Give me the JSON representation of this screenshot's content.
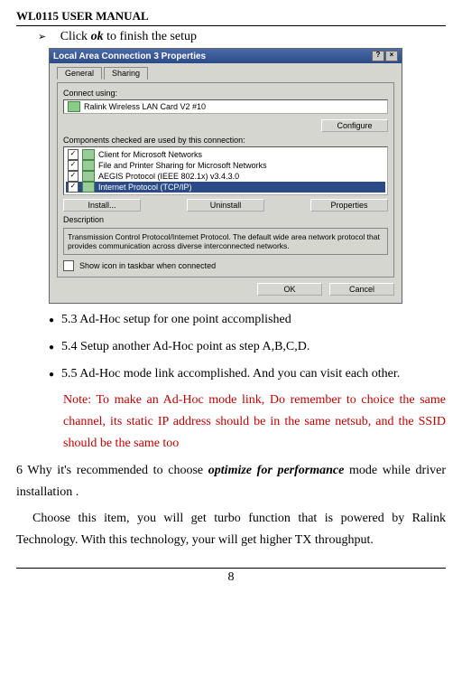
{
  "header": "WL0115 USER MANUAL",
  "bullet1_pre": "Click ",
  "bullet1_em": "ok",
  "bullet1_post": " to finish the setup",
  "dialog": {
    "title": "Local Area Connection 3 Properties",
    "tab_general": "General",
    "tab_sharing": "Sharing",
    "connect_using": "Connect using:",
    "adapter": "Ralink Wireless LAN Card V2 #10",
    "configure": "Configure",
    "components_label": "Components checked are used by this connection:",
    "comp1": "Client for Microsoft Networks",
    "comp2": "File and Printer Sharing for Microsoft Networks",
    "comp3": "AEGIS Protocol (IEEE 802.1x) v3.4.3.0",
    "comp4": "Internet Protocol (TCP/IP)",
    "install": "Install...",
    "uninstall": "Uninstall",
    "properties": "Properties",
    "desc_label": "Description",
    "desc_text": "Transmission Control Protocol/Internet Protocol. The default wide area network protocol that provides communication across diverse interconnected networks.",
    "show_icon": "Show icon in taskbar when connected",
    "ok": "OK",
    "cancel": "Cancel"
  },
  "item53": "5.3 Ad-Hoc setup for one point accomplished",
  "item54": "5.4 Setup another Ad-Hoc point as step A,B,C,D.",
  "item55": "5.5 Ad-Hoc mode link accomplished. And you can visit each other.",
  "note": "Note: To make an Ad-Hoc mode link, Do remember to choice the same channel, its static IP address should be in the same netsub, and the SSID should be the same too",
  "para6_pre": "6 Why it's recommended to choose ",
  "para6_em": "optimize for performance",
  "para6_post": " mode while driver installation .",
  "para7": "Choose this item, you will get turbo function that is powered by Ralink Technology. With this technology, your will get higher TX throughput.",
  "page_number": "8"
}
